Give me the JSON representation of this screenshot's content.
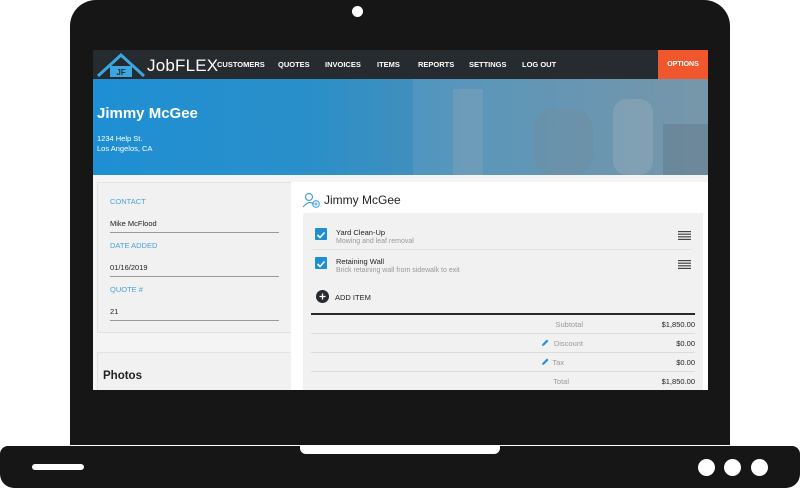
{
  "nav": {
    "logo_text": "JobFLEX",
    "items": [
      "CUSTOMERS",
      "QUOTES",
      "INVOICES",
      "ITEMS",
      "REPORTS",
      "SETTINGS",
      "LOG OUT"
    ],
    "options_label": "OPTIONS"
  },
  "hero": {
    "name": "Jimmy McGee",
    "address_line1": "1234 Help St.",
    "address_line2": "Los Angelos, CA"
  },
  "details": {
    "contact_label": "CONTACT",
    "contact_value": "Mike McFlood",
    "date_label": "DATE ADDED",
    "date_value": "01/16/2019",
    "quote_label": "QUOTE #",
    "quote_value": "21"
  },
  "photos": {
    "title": "Photos"
  },
  "quote": {
    "customer_name": "Jimmy McGee",
    "items": [
      {
        "title": "Yard Clean-Up",
        "description": "Mowing and leaf removal"
      },
      {
        "title": "Retaining Wall",
        "description": "Brick retaining wall from sidewalk to exit"
      }
    ],
    "add_item_label": "ADD ITEM",
    "summary": {
      "subtotal_label": "Subtotal",
      "subtotal_value": "$1,850.00",
      "discount_label": "Discount",
      "discount_value": "$0.00",
      "tax_label": "Tax",
      "tax_value": "$0.00",
      "total_label": "Total",
      "total_value": "$1,850.00"
    }
  },
  "colors": {
    "accent_blue": "#1e8fd4",
    "options_orange": "#f0572c",
    "navbar": "#262b30"
  }
}
